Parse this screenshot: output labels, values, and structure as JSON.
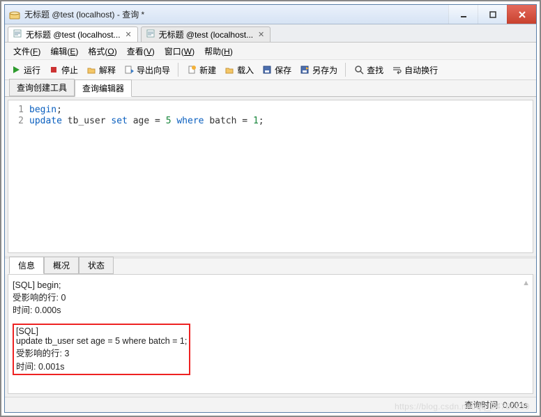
{
  "window": {
    "title": "无标题 @test (localhost) - 查询 *"
  },
  "docTabs": [
    {
      "label": "无标题 @test (localhost...",
      "active": true
    },
    {
      "label": "无标题 @test (localhost...",
      "active": false
    }
  ],
  "menu": {
    "file": {
      "text": "文件",
      "accel": "F"
    },
    "edit": {
      "text": "编辑",
      "accel": "E"
    },
    "format": {
      "text": "格式",
      "accel": "O"
    },
    "view": {
      "text": "查看",
      "accel": "V"
    },
    "window": {
      "text": "窗口",
      "accel": "W"
    },
    "help": {
      "text": "帮助",
      "accel": "H"
    }
  },
  "toolbar": {
    "run": "运行",
    "stop": "停止",
    "explain": "解释",
    "exportWiz": "导出向导",
    "new": "新建",
    "load": "载入",
    "save": "保存",
    "saveAs": "另存为",
    "find": "查找",
    "wrap": "自动换行"
  },
  "innerTabs": {
    "builder": "查询创建工具",
    "editor": "查询编辑器"
  },
  "code": {
    "lineNumbers": [
      "1",
      "2"
    ],
    "lines": [
      {
        "tokens": [
          {
            "t": "begin",
            "c": "kw"
          },
          {
            "t": ";",
            "c": ""
          }
        ]
      },
      {
        "tokens": [
          {
            "t": "update",
            "c": "kw"
          },
          {
            "t": " tb_user ",
            "c": ""
          },
          {
            "t": "set",
            "c": "kw"
          },
          {
            "t": " age = ",
            "c": ""
          },
          {
            "t": "5",
            "c": "num"
          },
          {
            "t": " ",
            "c": ""
          },
          {
            "t": "where",
            "c": "kw"
          },
          {
            "t": " batch = ",
            "c": ""
          },
          {
            "t": "1",
            "c": "num"
          },
          {
            "t": ";",
            "c": ""
          }
        ]
      }
    ]
  },
  "outputTabs": {
    "info": "信息",
    "profile": "概况",
    "status": "状态"
  },
  "output": {
    "block1": {
      "l1": "[SQL] begin;",
      "l2": "受影响的行: 0",
      "l3": "时间: 0.000s"
    },
    "block2": {
      "l1": "[SQL]",
      "l2": "update tb_user set age = 5 where batch = 1;",
      "l3": "受影响的行: 3",
      "l4": "时间: 0.001s"
    }
  },
  "status": {
    "queryTime": "查询时间: 0.001s"
  },
  "watermark": "https://blog.csdn.net/qq_24760259"
}
